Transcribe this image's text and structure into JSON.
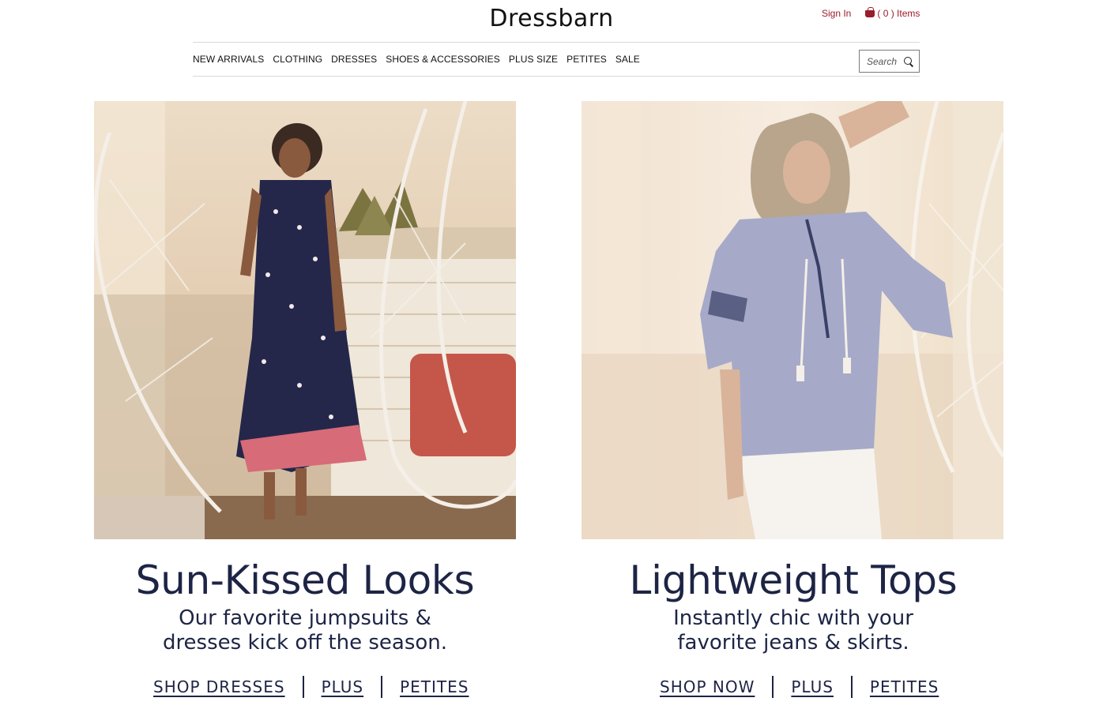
{
  "brand": {
    "logo": "Dressbarn"
  },
  "utility": {
    "sign_in": "Sign In",
    "cart": "( 0 ) Items"
  },
  "nav": {
    "items": [
      "NEW ARRIVALS",
      "CLOTHING",
      "DRESSES",
      "SHOES & ACCESSORIES",
      "PLUS SIZE",
      "PETITES",
      "SALE"
    ]
  },
  "search": {
    "placeholder": "Search"
  },
  "promos": [
    {
      "headline": "Sun-Kissed Looks",
      "sub_line1": "Our favorite jumpsuits &",
      "sub_line2": "dresses kick off the season.",
      "links": [
        "SHOP DRESSES",
        "PLUS",
        "PETITES"
      ]
    },
    {
      "headline": "Lightweight Tops",
      "sub_line1": "Instantly chic with your",
      "sub_line2": "favorite jeans & skirts.",
      "links": [
        "SHOP NOW",
        "PLUS",
        "PETITES"
      ]
    }
  ],
  "colors": {
    "brand_red": "#9b1c2a",
    "navy_text": "#1d2445"
  }
}
